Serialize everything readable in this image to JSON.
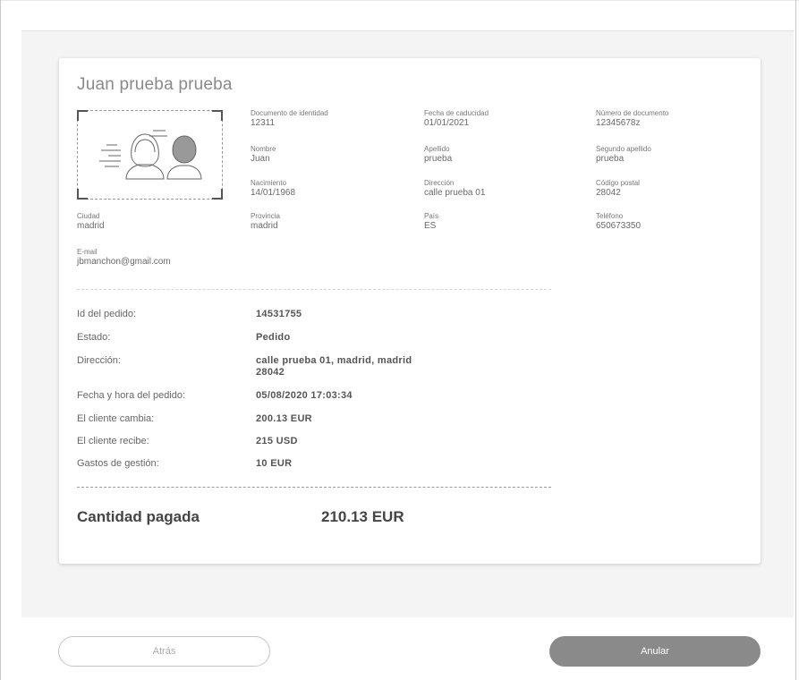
{
  "customer": {
    "full_name": "Juan prueba prueba"
  },
  "fields": {
    "doc_identity": {
      "label": "Documento de identidad",
      "value": "12311"
    },
    "expiry": {
      "label": "Fecha de caducidad",
      "value": "01/01/2021"
    },
    "doc_number": {
      "label": "Número de documento",
      "value": "12345678z"
    },
    "first_name": {
      "label": "Nombre",
      "value": "Juan"
    },
    "surname": {
      "label": "Apellido",
      "value": "prueba"
    },
    "second_surname": {
      "label": "Segundo apellido",
      "value": "prueba"
    },
    "birth": {
      "label": "Nacimiento",
      "value": "14/01/1968"
    },
    "address": {
      "label": "Dirección",
      "value": "calle prueba 01"
    },
    "postal_code": {
      "label": "Código postal",
      "value": "28042"
    },
    "city": {
      "label": "Ciudad",
      "value": "madrid"
    },
    "province": {
      "label": "Provincia",
      "value": "madrid"
    },
    "country": {
      "label": "País",
      "value": "ES"
    },
    "phone": {
      "label": "Teléfono",
      "value": "650673350"
    },
    "email": {
      "label": "E-mail",
      "value": "jbmanchon@gmail.com"
    }
  },
  "order": {
    "id_label": "Id del pedido:",
    "id_value": "14531755",
    "status_label": "Estado:",
    "status_value": "Pedido",
    "address_label": "Dirección:",
    "address_line1": "calle prueba 01, madrid, madrid",
    "address_line2": "28042",
    "datetime_label": "Fecha y hora del pedido:",
    "datetime_value": "05/08/2020 17:03:34",
    "exchange_label": "El cliente cambia:",
    "exchange_value": "200.13 EUR",
    "receive_label": "El cliente recibe:",
    "receive_value": "215 USD",
    "fees_label": "Gastos de gestión:",
    "fees_value": "10 EUR"
  },
  "total": {
    "label": "Cantidad pagada",
    "value": "210.13 EUR"
  },
  "buttons": {
    "back": "Atrás",
    "cancel": "Anular"
  },
  "icons": {
    "document": "id-document-people-icon"
  }
}
